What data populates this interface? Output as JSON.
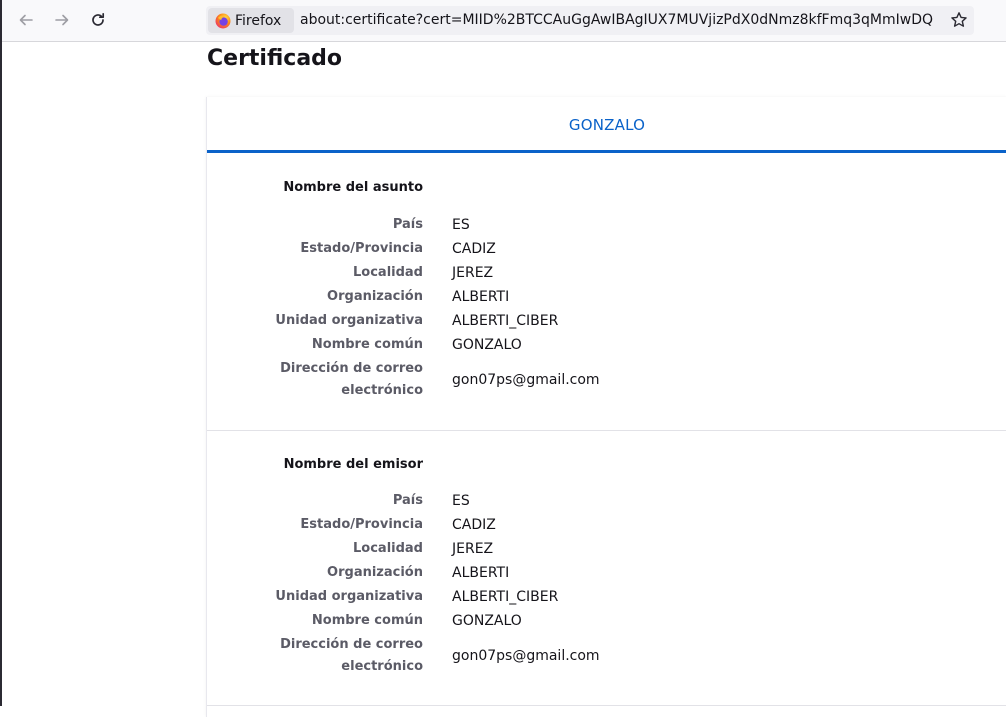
{
  "browser": {
    "identity_label": "Firefox",
    "url": "about:certificate?cert=MIID%2BTCCAuGgAwIBAgIUX7MUVjizPdX0dNmz8kfFmq3qMmIwDQ",
    "icons": {
      "back": "arrow-left-icon",
      "forward": "arrow-right-icon",
      "reload": "reload-icon",
      "bookmark": "star-icon",
      "brand": "firefox-logo"
    }
  },
  "page": {
    "title": "Certificado",
    "tab_label": "GONZALO",
    "accent_color": "#0a62c9"
  },
  "subject": {
    "title": "Nombre del asunto",
    "rows": [
      {
        "label": "País",
        "value": "ES"
      },
      {
        "label": "Estado/Provincia",
        "value": "CADIZ"
      },
      {
        "label": "Localidad",
        "value": "JEREZ"
      },
      {
        "label": "Organización",
        "value": "ALBERTI"
      },
      {
        "label": "Unidad organizativa",
        "value": "ALBERTI_CIBER"
      },
      {
        "label": "Nombre común",
        "value": "GONZALO"
      }
    ],
    "email_label_line1": "Dirección de correo",
    "email_label_line2": "electrónico",
    "email_value": "gon07ps@gmail.com"
  },
  "issuer": {
    "title": "Nombre del emisor",
    "rows": [
      {
        "label": "País",
        "value": "ES"
      },
      {
        "label": "Estado/Provincia",
        "value": "CADIZ"
      },
      {
        "label": "Localidad",
        "value": "JEREZ"
      },
      {
        "label": "Organización",
        "value": "ALBERTI"
      },
      {
        "label": "Unidad organizativa",
        "value": "ALBERTI_CIBER"
      },
      {
        "label": "Nombre común",
        "value": "GONZALO"
      }
    ],
    "email_label_line1": "Dirección de correo",
    "email_label_line2": "electrónico",
    "email_value": "gon07ps@gmail.com"
  }
}
